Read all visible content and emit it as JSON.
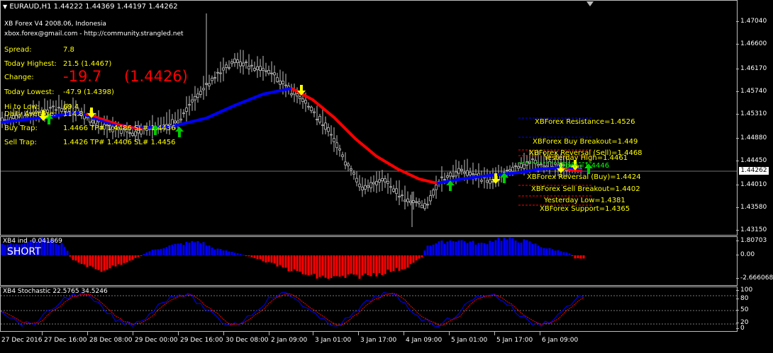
{
  "header": {
    "symbol_line": "EURAUD,H1  1.44222 1.44369 1.44197 1.44262"
  },
  "brand": {
    "line1": "XB Forex V4 2008.06, Indonesia",
    "line2": "xbox.forex@gmail.com  -  http://community.strangled.net"
  },
  "stats": {
    "spread_label": "Spread:",
    "spread_value": "7.8",
    "high_label": "Today Highest:",
    "high_value": "21.5   (1.4467)",
    "change_label": "Change:",
    "change_value": "-19.7",
    "change_price": "(1.4426)",
    "low_label": "Today Lowest:",
    "low_value": "-47.9   (1.4398)",
    "hi_low_label": "Hi to Low:",
    "hi_low_value": "69.4",
    "daily_avg_label": "Daily Average:",
    "daily_avg_value": "114.8",
    "buy_trap_label": "Buy Trap:",
    "buy_trap_value": "1.4466 TP# 1.4486 SL# 1.4436",
    "sell_trap_label": "Sell Trap:",
    "sell_trap_value": "1.4426 TP# 1.4406 SL# 1.4456"
  },
  "levels": [
    {
      "text": "XBForex Resistance=1.4526",
      "color": "#ffff00"
    },
    {
      "text": "XBForex Buy Breakout=1.449",
      "color": "#ffff00"
    },
    {
      "text": "XBForex Reversal (Sell)=1.4468",
      "color": "#ffff00"
    },
    {
      "text": "Yesterday High=1.4461",
      "color": "#ffff00"
    },
    {
      "text": "Open=1.4446",
      "color": "#00ff00"
    },
    {
      "text": "XBForex Reversal (Buy)=1.4424",
      "color": "#ffff00"
    },
    {
      "text": "XBForex Sell Breakout=1.4402",
      "color": "#ffff00"
    },
    {
      "text": "Yesterday Low=1.4381",
      "color": "#ffff00"
    },
    {
      "text": "XBForex Support=1.4365",
      "color": "#ffff00"
    }
  ],
  "price_axis": {
    "ticks": [
      "1.47040",
      "1.46600",
      "1.46170",
      "1.45740",
      "1.45310",
      "1.44880",
      "1.44450",
      "1.44010",
      "1.43580",
      "1.43150"
    ],
    "current": "1.44262"
  },
  "indicator": {
    "title": "XB4 ind -0.041869",
    "signal": "SHORT",
    "ticks": [
      "1.80703",
      "0.00",
      "-2.666068"
    ],
    "bull_color": "#0000ff",
    "bear_color": "#ff0000"
  },
  "stochastic": {
    "title": "XB4 Stochastic 22.5765 34.5246",
    "ticks": [
      "100",
      "80",
      "50",
      "20",
      "0"
    ]
  },
  "time_axis": [
    "27 Dec 2016",
    "27 Dec 16:00",
    "28 Dec 08:00",
    "29 Dec 00:00",
    "29 Dec 16:00",
    "30 Dec 08:00",
    "2 Jan 09:00",
    "3 Jan 01:00",
    "3 Jan 17:00",
    "4 Jan 09:00",
    "5 Jan 01:00",
    "5 Jan 17:00",
    "6 Jan 09:00"
  ],
  "colors": {
    "ma_up": "#0000ff",
    "ma_down": "#ff0000",
    "candle": "#c0c0c0",
    "text_yellow": "#ffff00",
    "text_red": "#ff0000",
    "arrow_buy": "#00cc00",
    "arrow_sell": "#ffff00"
  }
}
